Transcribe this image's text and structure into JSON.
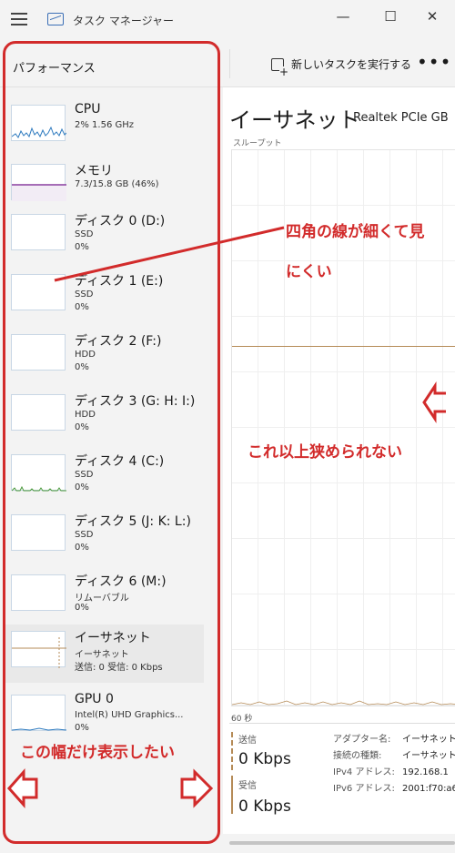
{
  "window": {
    "title": "タスク マネージャー",
    "minimize": "—",
    "maximize": "☐",
    "close": "✕"
  },
  "toolbar": {
    "section_label": "パフォーマンス",
    "run_task": "新しいタスクを実行する",
    "more": "•••"
  },
  "sidebar": {
    "items": [
      {
        "title": "CPU",
        "line1": "2%  1.56 GHz",
        "line2": "",
        "graph": "blue-spikes"
      },
      {
        "title": "メモリ",
        "line1": "7.3/15.8 GB (46%)",
        "line2": "",
        "graph": "purple-flat"
      },
      {
        "title": "ディスク 0 (D:)",
        "line1": "SSD",
        "line2": "0%",
        "graph": "empty"
      },
      {
        "title": "ディスク 1 (E:)",
        "line1": "SSD",
        "line2": "0%",
        "graph": "empty"
      },
      {
        "title": "ディスク 2 (F:)",
        "line1": "HDD",
        "line2": "0%",
        "graph": "empty"
      },
      {
        "title": "ディスク 3 (G: H: I:)",
        "line1": "HDD",
        "line2": "0%",
        "graph": "empty"
      },
      {
        "title": "ディスク 4 (C:)",
        "line1": "SSD",
        "line2": "0%",
        "graph": "green-spikes"
      },
      {
        "title": "ディスク 5 (J: K: L:)",
        "line1": "SSD",
        "line2": "0%",
        "graph": "empty"
      },
      {
        "title": "ディスク 6 (M:)",
        "line1": "リムーバブル",
        "line2": "0%",
        "graph": "empty"
      },
      {
        "title": "イーサネット",
        "line1": "イーサネット",
        "line2": "送信: 0 受信: 0 Kbps",
        "graph": "orange-spike"
      },
      {
        "title": "GPU 0",
        "line1": "Intel(R) UHD Graphics...",
        "line2": "0%",
        "graph": "blue-low"
      }
    ]
  },
  "main": {
    "title": "イーサネット",
    "adapter": "Realtek PCIe GB",
    "throughput_label": "スループット",
    "time_label": "60 秒",
    "send_label": "送信",
    "send_value": "0 Kbps",
    "recv_label": "受信",
    "recv_value": "0 Kbps",
    "props": {
      "adapter_name_label": "アダプター名:",
      "adapter_name_value": "イーサネット",
      "conn_type_label": "接続の種類:",
      "conn_type_value": "イーサネット",
      "ipv4_label": "IPv4 アドレス:",
      "ipv4_value": "192.168.1",
      "ipv6_label": "IPv6 アドレス:",
      "ipv6_value": "2001:f70:a6"
    }
  },
  "annotations": {
    "thin_lines_1": "四角の線が細くて見",
    "thin_lines_2": "にくい",
    "cannot_narrow": "これ以上狭められない",
    "show_this_width": "この幅だけ表示したい",
    "color": "#d22b2b"
  }
}
